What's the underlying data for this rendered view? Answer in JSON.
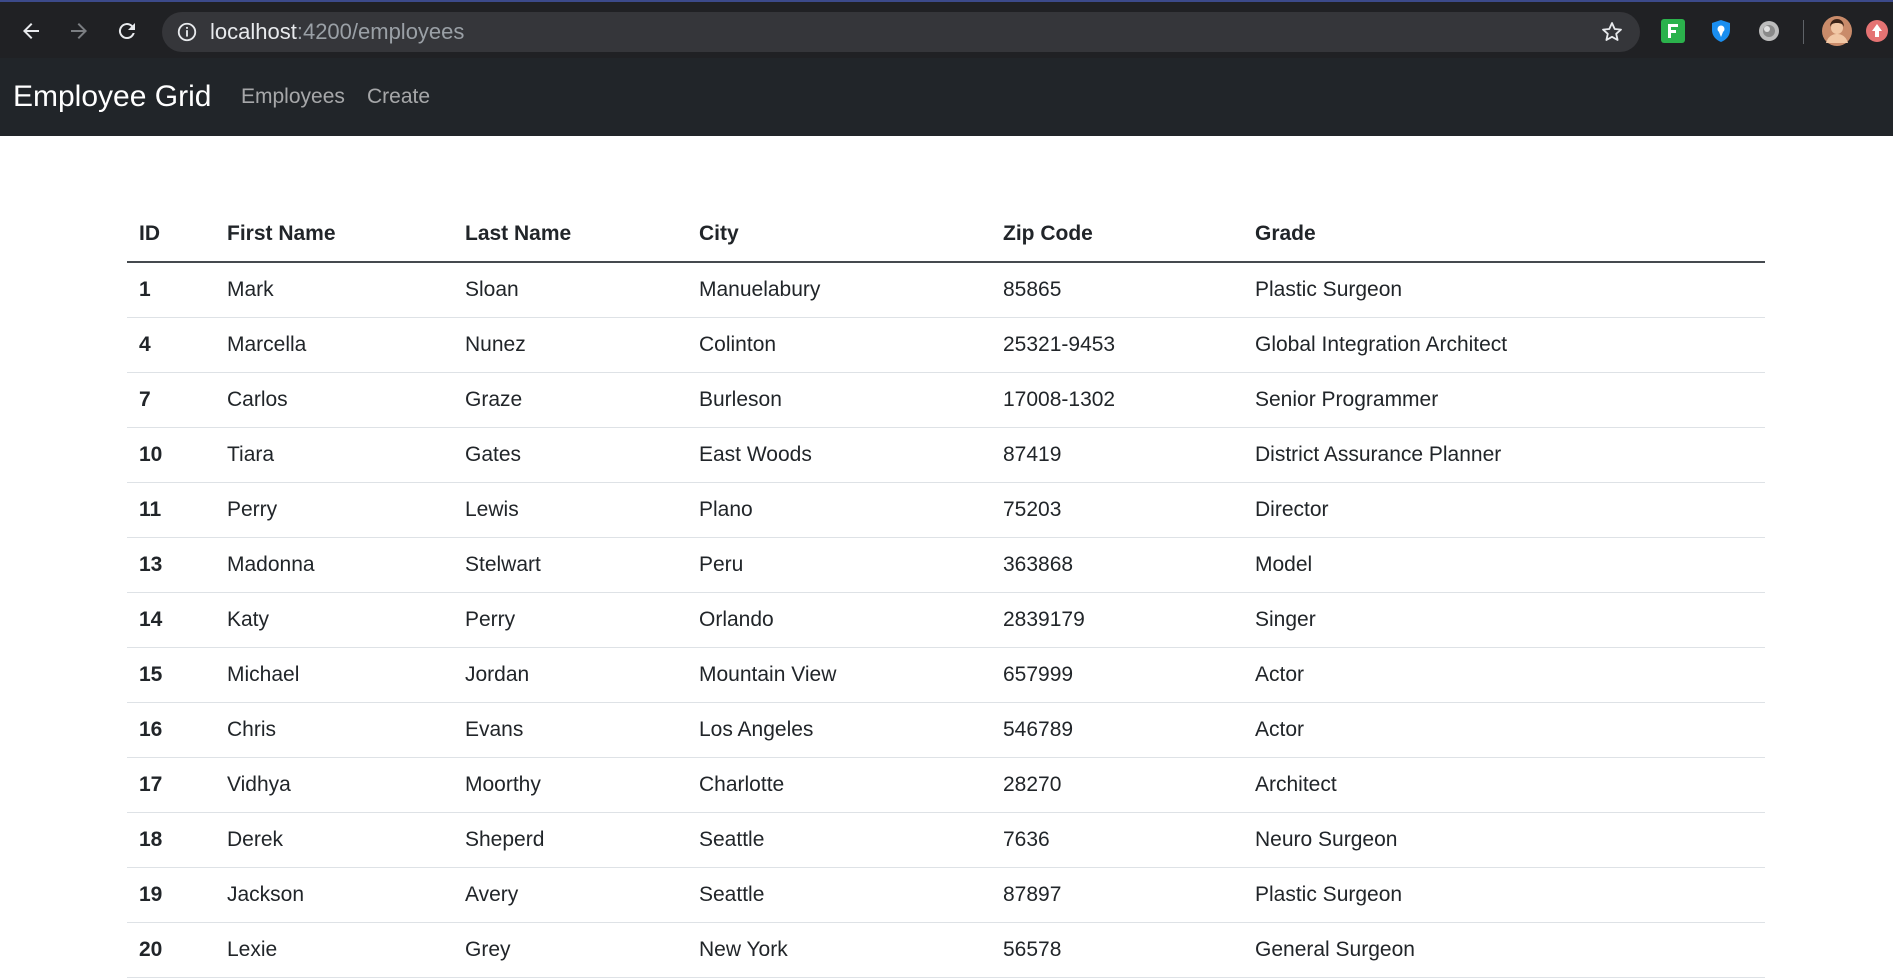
{
  "browser": {
    "url_host": "localhost",
    "url_path": ":4200/employees"
  },
  "navbar": {
    "brand": "Employee Grid",
    "links": [
      "Employees",
      "Create"
    ]
  },
  "table": {
    "headers": [
      "ID",
      "First Name",
      "Last Name",
      "City",
      "Zip Code",
      "Grade"
    ],
    "rows": [
      [
        "1",
        "Mark",
        "Sloan",
        "Manuelabury",
        "85865",
        "Plastic Surgeon"
      ],
      [
        "4",
        "Marcella",
        "Nunez",
        "Colinton",
        "25321-9453",
        "Global Integration Architect"
      ],
      [
        "7",
        "Carlos",
        "Graze",
        "Burleson",
        "17008-1302",
        "Senior Programmer"
      ],
      [
        "10",
        "Tiara",
        "Gates",
        "East Woods",
        "87419",
        "District Assurance Planner"
      ],
      [
        "11",
        "Perry",
        "Lewis",
        "Plano",
        "75203",
        "Director"
      ],
      [
        "13",
        "Madonna",
        "Stelwart",
        "Peru",
        "363868",
        "Model"
      ],
      [
        "14",
        "Katy",
        "Perry",
        "Orlando",
        "2839179",
        "Singer"
      ],
      [
        "15",
        "Michael",
        "Jordan",
        "Mountain View",
        "657999",
        "Actor"
      ],
      [
        "16",
        "Chris",
        "Evans",
        "Los Angeles",
        "546789",
        "Actor"
      ],
      [
        "17",
        "Vidhya",
        "Moorthy",
        "Charlotte",
        "28270",
        "Architect"
      ],
      [
        "18",
        "Derek",
        "Sheperd",
        "Seattle",
        "7636",
        "Neuro Surgeon"
      ],
      [
        "19",
        "Jackson",
        "Avery",
        "Seattle",
        "87897",
        "Plastic Surgeon"
      ],
      [
        "20",
        "Lexie",
        "Grey",
        "New York",
        "56578",
        "General Surgeon"
      ]
    ]
  },
  "colors": {
    "chrome_bg": "#202124",
    "omnibox_bg": "#35363a",
    "navbar_bg": "#212529",
    "text": "#212529"
  }
}
